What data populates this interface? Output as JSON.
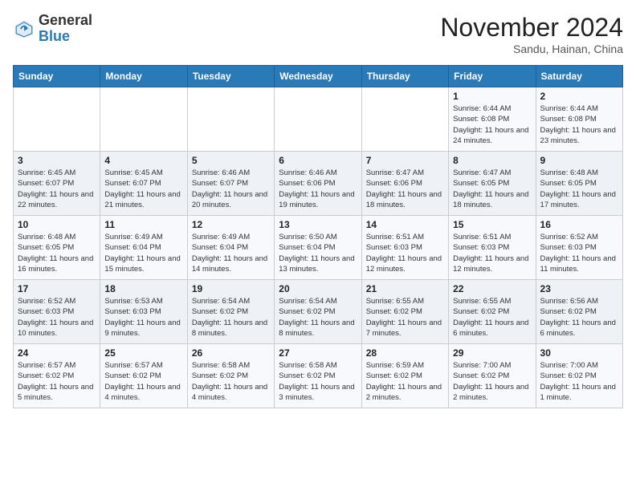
{
  "header": {
    "logo_general": "General",
    "logo_blue": "Blue",
    "month_title": "November 2024",
    "location": "Sandu, Hainan, China"
  },
  "days_of_week": [
    "Sunday",
    "Monday",
    "Tuesday",
    "Wednesday",
    "Thursday",
    "Friday",
    "Saturday"
  ],
  "weeks": [
    [
      {
        "day": "",
        "info": ""
      },
      {
        "day": "",
        "info": ""
      },
      {
        "day": "",
        "info": ""
      },
      {
        "day": "",
        "info": ""
      },
      {
        "day": "",
        "info": ""
      },
      {
        "day": "1",
        "info": "Sunrise: 6:44 AM\nSunset: 6:08 PM\nDaylight: 11 hours and 24 minutes."
      },
      {
        "day": "2",
        "info": "Sunrise: 6:44 AM\nSunset: 6:08 PM\nDaylight: 11 hours and 23 minutes."
      }
    ],
    [
      {
        "day": "3",
        "info": "Sunrise: 6:45 AM\nSunset: 6:07 PM\nDaylight: 11 hours and 22 minutes."
      },
      {
        "day": "4",
        "info": "Sunrise: 6:45 AM\nSunset: 6:07 PM\nDaylight: 11 hours and 21 minutes."
      },
      {
        "day": "5",
        "info": "Sunrise: 6:46 AM\nSunset: 6:07 PM\nDaylight: 11 hours and 20 minutes."
      },
      {
        "day": "6",
        "info": "Sunrise: 6:46 AM\nSunset: 6:06 PM\nDaylight: 11 hours and 19 minutes."
      },
      {
        "day": "7",
        "info": "Sunrise: 6:47 AM\nSunset: 6:06 PM\nDaylight: 11 hours and 18 minutes."
      },
      {
        "day": "8",
        "info": "Sunrise: 6:47 AM\nSunset: 6:05 PM\nDaylight: 11 hours and 18 minutes."
      },
      {
        "day": "9",
        "info": "Sunrise: 6:48 AM\nSunset: 6:05 PM\nDaylight: 11 hours and 17 minutes."
      }
    ],
    [
      {
        "day": "10",
        "info": "Sunrise: 6:48 AM\nSunset: 6:05 PM\nDaylight: 11 hours and 16 minutes."
      },
      {
        "day": "11",
        "info": "Sunrise: 6:49 AM\nSunset: 6:04 PM\nDaylight: 11 hours and 15 minutes."
      },
      {
        "day": "12",
        "info": "Sunrise: 6:49 AM\nSunset: 6:04 PM\nDaylight: 11 hours and 14 minutes."
      },
      {
        "day": "13",
        "info": "Sunrise: 6:50 AM\nSunset: 6:04 PM\nDaylight: 11 hours and 13 minutes."
      },
      {
        "day": "14",
        "info": "Sunrise: 6:51 AM\nSunset: 6:03 PM\nDaylight: 11 hours and 12 minutes."
      },
      {
        "day": "15",
        "info": "Sunrise: 6:51 AM\nSunset: 6:03 PM\nDaylight: 11 hours and 12 minutes."
      },
      {
        "day": "16",
        "info": "Sunrise: 6:52 AM\nSunset: 6:03 PM\nDaylight: 11 hours and 11 minutes."
      }
    ],
    [
      {
        "day": "17",
        "info": "Sunrise: 6:52 AM\nSunset: 6:03 PM\nDaylight: 11 hours and 10 minutes."
      },
      {
        "day": "18",
        "info": "Sunrise: 6:53 AM\nSunset: 6:03 PM\nDaylight: 11 hours and 9 minutes."
      },
      {
        "day": "19",
        "info": "Sunrise: 6:54 AM\nSunset: 6:02 PM\nDaylight: 11 hours and 8 minutes."
      },
      {
        "day": "20",
        "info": "Sunrise: 6:54 AM\nSunset: 6:02 PM\nDaylight: 11 hours and 8 minutes."
      },
      {
        "day": "21",
        "info": "Sunrise: 6:55 AM\nSunset: 6:02 PM\nDaylight: 11 hours and 7 minutes."
      },
      {
        "day": "22",
        "info": "Sunrise: 6:55 AM\nSunset: 6:02 PM\nDaylight: 11 hours and 6 minutes."
      },
      {
        "day": "23",
        "info": "Sunrise: 6:56 AM\nSunset: 6:02 PM\nDaylight: 11 hours and 6 minutes."
      }
    ],
    [
      {
        "day": "24",
        "info": "Sunrise: 6:57 AM\nSunset: 6:02 PM\nDaylight: 11 hours and 5 minutes."
      },
      {
        "day": "25",
        "info": "Sunrise: 6:57 AM\nSunset: 6:02 PM\nDaylight: 11 hours and 4 minutes."
      },
      {
        "day": "26",
        "info": "Sunrise: 6:58 AM\nSunset: 6:02 PM\nDaylight: 11 hours and 4 minutes."
      },
      {
        "day": "27",
        "info": "Sunrise: 6:58 AM\nSunset: 6:02 PM\nDaylight: 11 hours and 3 minutes."
      },
      {
        "day": "28",
        "info": "Sunrise: 6:59 AM\nSunset: 6:02 PM\nDaylight: 11 hours and 2 minutes."
      },
      {
        "day": "29",
        "info": "Sunrise: 7:00 AM\nSunset: 6:02 PM\nDaylight: 11 hours and 2 minutes."
      },
      {
        "day": "30",
        "info": "Sunrise: 7:00 AM\nSunset: 6:02 PM\nDaylight: 11 hours and 1 minute."
      }
    ]
  ]
}
